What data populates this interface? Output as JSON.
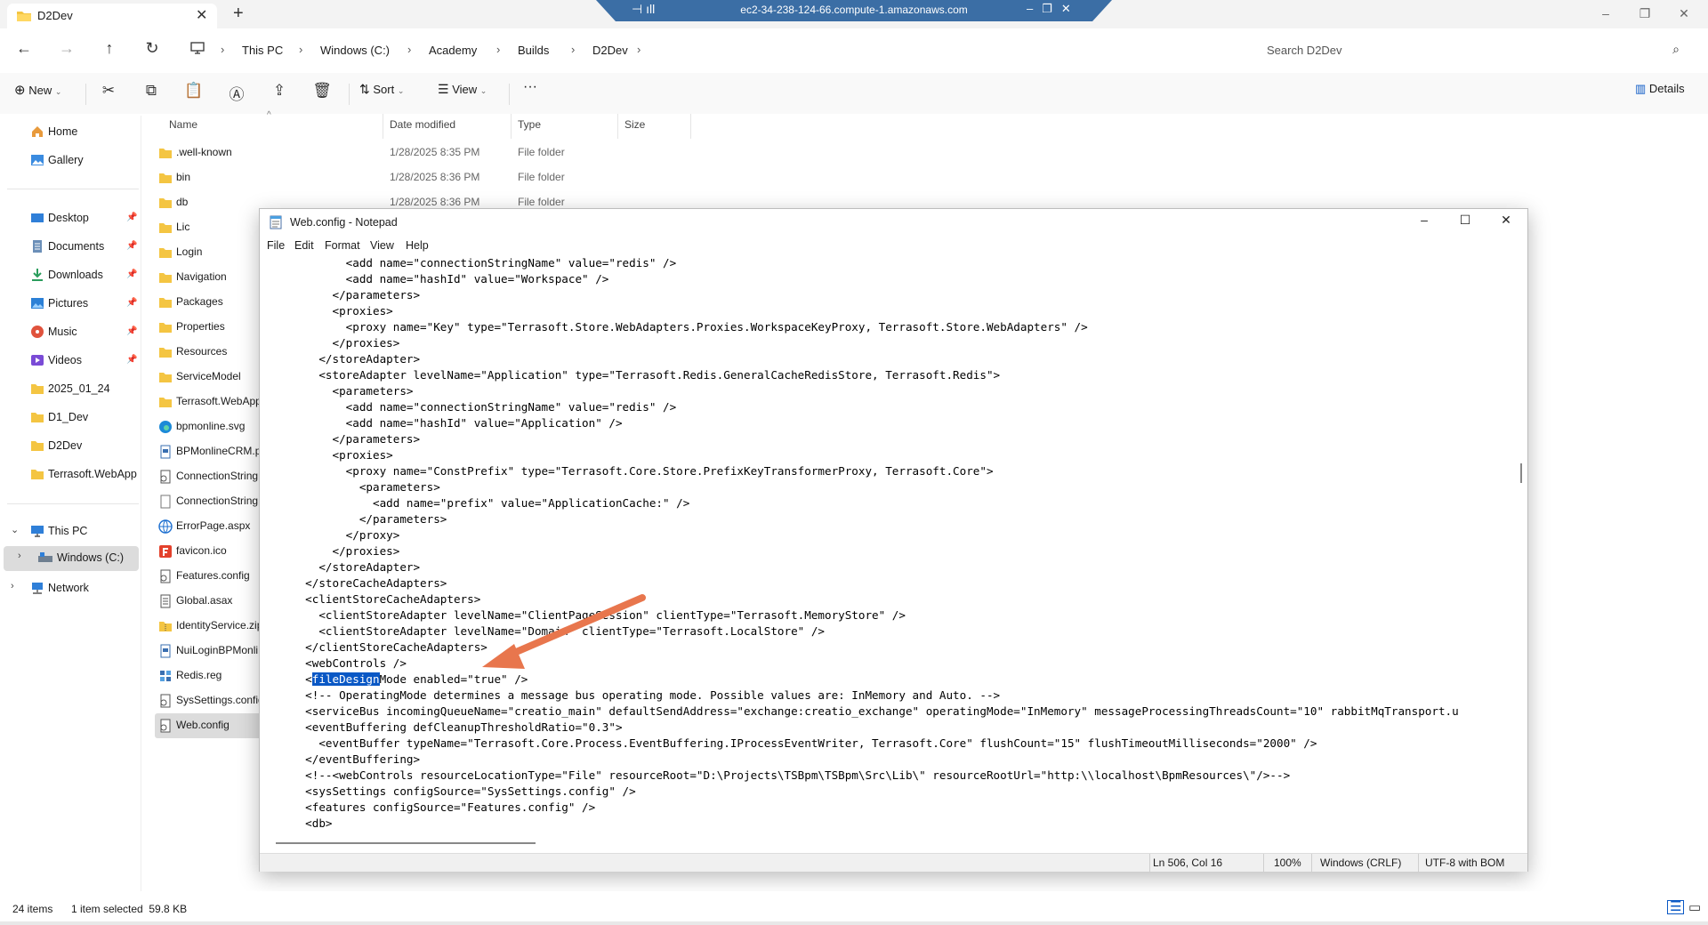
{
  "explorer": {
    "tab_title": "D2Dev",
    "remote_host": "ec2-34-238-124-66.compute-1.amazonaws.com",
    "breadcrumbs": [
      "This PC",
      "Windows (C:)",
      "Academy",
      "Builds",
      "D2Dev"
    ],
    "search_placeholder": "Search D2Dev",
    "toolbar": {
      "new_label": "New",
      "sort_label": "Sort",
      "view_label": "View",
      "more_label": "···",
      "details_label": "Details"
    },
    "nav": {
      "home": "Home",
      "gallery": "Gallery",
      "quick_access": [
        "Desktop",
        "Documents",
        "Downloads",
        "Pictures",
        "Music",
        "Videos",
        "2025_01_24",
        "D1_Dev",
        "D2Dev",
        "Terrasoft.WebApp"
      ],
      "this_pc": "This PC",
      "windows_c": "Windows (C:)",
      "network": "Network"
    },
    "columns": {
      "name": "Name",
      "date": "Date modified",
      "type": "Type",
      "size": "Size"
    },
    "files": [
      {
        "name": ".well-known",
        "date": "1/28/2025 8:35 PM",
        "type": "File folder"
      },
      {
        "name": "bin",
        "date": "1/28/2025 8:36 PM",
        "type": "File folder"
      },
      {
        "name": "db",
        "date": "1/28/2025 8:36 PM",
        "type": "File folder"
      },
      {
        "name": "Lic",
        "date": "",
        "type": ""
      },
      {
        "name": "Login",
        "date": "",
        "type": ""
      },
      {
        "name": "Navigation",
        "date": "",
        "type": ""
      },
      {
        "name": "Packages",
        "date": "",
        "type": ""
      },
      {
        "name": "Properties",
        "date": "",
        "type": ""
      },
      {
        "name": "Resources",
        "date": "",
        "type": ""
      },
      {
        "name": "ServiceModel",
        "date": "",
        "type": ""
      },
      {
        "name": "Terrasoft.WebApp",
        "date": "",
        "type": ""
      },
      {
        "name": "bpmonline.svg",
        "date": "",
        "type": ""
      },
      {
        "name": "BPMonlineCRM.p",
        "date": "",
        "type": ""
      },
      {
        "name": "ConnectionString",
        "date": "",
        "type": ""
      },
      {
        "name": "ConnectionString",
        "date": "",
        "type": ""
      },
      {
        "name": "ErrorPage.aspx",
        "date": "",
        "type": ""
      },
      {
        "name": "favicon.ico",
        "date": "",
        "type": ""
      },
      {
        "name": "Features.config",
        "date": "",
        "type": ""
      },
      {
        "name": "Global.asax",
        "date": "",
        "type": ""
      },
      {
        "name": "IdentityService.zip",
        "date": "",
        "type": ""
      },
      {
        "name": "NuiLoginBPMonli",
        "date": "",
        "type": ""
      },
      {
        "name": "Redis.reg",
        "date": "",
        "type": ""
      },
      {
        "name": "SysSettings.config",
        "date": "",
        "type": ""
      },
      {
        "name": "Web.config",
        "date": "",
        "type": ""
      }
    ],
    "status": {
      "items": "24 items",
      "selected": "1 item selected  59.8 KB"
    }
  },
  "notepad": {
    "title": "Web.config - Notepad",
    "menu": [
      "File",
      "Edit",
      "Format",
      "View",
      "Help"
    ],
    "selected_text": "fileDesign",
    "lines_before": [
      "        <add name=\"connectionStringName\" value=\"redis\" />",
      "        <add name=\"hashId\" value=\"Workspace\" />",
      "      </parameters>",
      "      <proxies>",
      "        <proxy name=\"Key\" type=\"Terrasoft.Store.WebAdapters.Proxies.WorkspaceKeyProxy, Terrasoft.Store.WebAdapters\" />",
      "      </proxies>",
      "    </storeAdapter>",
      "    <storeAdapter levelName=\"Application\" type=\"Terrasoft.Redis.GeneralCacheRedisStore, Terrasoft.Redis\">",
      "      <parameters>",
      "        <add name=\"connectionStringName\" value=\"redis\" />",
      "        <add name=\"hashId\" value=\"Application\" />",
      "      </parameters>",
      "      <proxies>",
      "        <proxy name=\"ConstPrefix\" type=\"Terrasoft.Core.Store.PrefixKeyTransformerProxy, Terrasoft.Core\">",
      "          <parameters>",
      "            <add name=\"prefix\" value=\"ApplicationCache:\" />",
      "          </parameters>",
      "        </proxy>",
      "      </proxies>",
      "    </storeAdapter>",
      "  </storeCacheAdapters>",
      "  <clientStoreCacheAdapters>",
      "    <clientStoreAdapter levelName=\"ClientPageSession\" clientType=\"Terrasoft.MemoryStore\" />",
      "    <clientStoreAdapter levelName=\"Domain\" clientType=\"Terrasoft.LocalStore\" />",
      "  </clientStoreCacheAdapters>",
      "  <webControls />"
    ],
    "sel_line_prefix": "  <",
    "sel_line_suffix": "Mode enabled=\"true\" />",
    "lines_after": [
      "  <!-- OperatingMode determines a message bus operating mode. Possible values are: InMemory and Auto. -->",
      "  <serviceBus incomingQueueName=\"creatio_main\" defaultSendAddress=\"exchange:creatio_exchange\" operatingMode=\"InMemory\" messageProcessingThreadsCount=\"10\" rabbitMqTransport.u",
      "  <eventBuffering defCleanupThresholdRatio=\"0.3\">",
      "    <eventBuffer typeName=\"Terrasoft.Core.Process.EventBuffering.IProcessEventWriter, Terrasoft.Core\" flushCount=\"15\" flushTimeoutMilliseconds=\"2000\" />",
      "  </eventBuffering>",
      "  <!--<webControls resourceLocationType=\"File\" resourceRoot=\"D:\\Projects\\TSBpm\\TSBpm\\Src\\Lib\\\" resourceRootUrl=\"http:\\\\localhost\\BpmResources\\\"/>-->",
      "  <sysSettings configSource=\"SysSettings.config\" />",
      "  <features configSource=\"Features.config\" />",
      "  <db>"
    ],
    "status": {
      "position": "Ln 506, Col 16",
      "zoom": "100%",
      "line_ending": "Windows (CRLF)",
      "encoding": "UTF-8 with BOM"
    }
  },
  "colors": {
    "accent": "#0a58c5",
    "arrow": "#e8764d",
    "rdp_bar": "#3b6ea5"
  }
}
